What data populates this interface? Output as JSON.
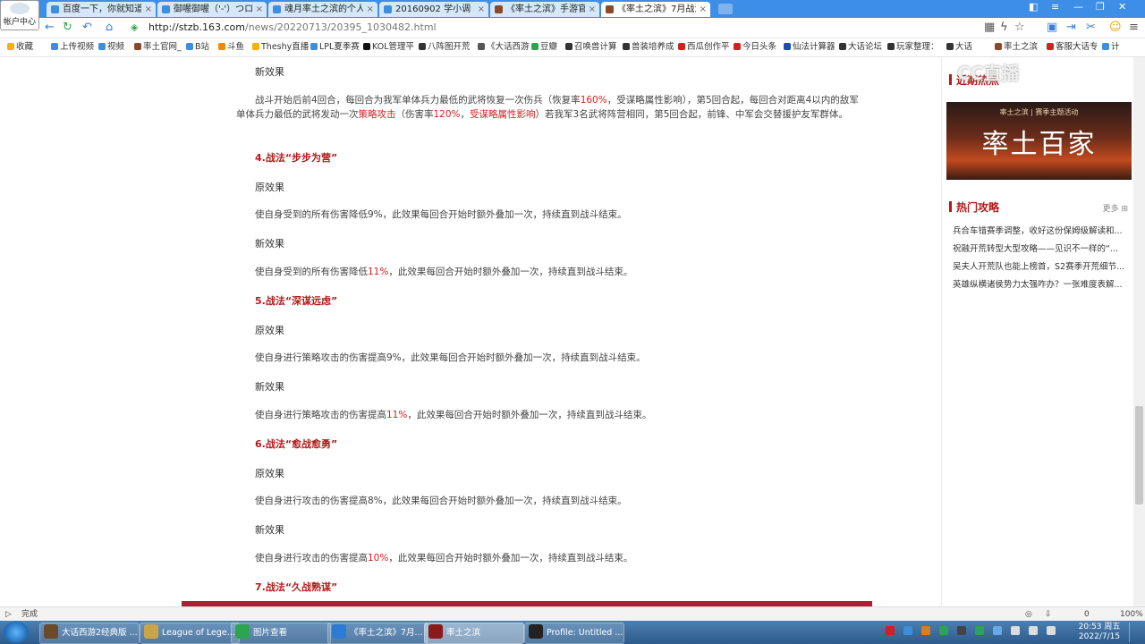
{
  "browser": {
    "account_label": "帐户中心",
    "tabs": [
      {
        "title": "百度一下，你就知道"
      },
      {
        "title": "御喔御喔（'-'）つロ 干"
      },
      {
        "title": "魂月率土之滨的个人空间"
      },
      {
        "title": "20160902 学小调 郭德"
      },
      {
        "title": "《率土之滨》手游官网_"
      },
      {
        "title": "《率土之滨》7月战法平"
      }
    ],
    "close_glyph": "×",
    "url_host": "http://stzb.163.com",
    "url_path": "/news/20220713/20395_1030482.html",
    "bookmarks": [
      "收藏",
      "上传视频",
      "视频",
      "率土官网_",
      "B站",
      "斗鱼",
      "Theshy直播",
      "LPL夏季赛",
      "KOL管理平",
      "八阵图开荒",
      "《大话西游",
      "豆瓣",
      "召唤兽计算",
      "兽装培养成",
      "西瓜创作平",
      "今日头条",
      "仙法计算器",
      "大话论坛",
      "玩家整理：",
      "大话",
      "率土之滨",
      "客服大话专",
      "计"
    ]
  },
  "article": {
    "top_label": "新效果",
    "top_para_1": "战斗开始后前4回合，每回合为我军单体兵力最低的武将恢复一次伤兵（恢复率",
    "top_para_r1": "160%",
    "top_para_2": "，受谋略属性影响），第5回合起，每回合对距离4以内的敌军单体兵力最低的武将发动一次",
    "top_para_r2": "策略攻击",
    "top_para_3": "（伤害率",
    "top_para_r3": "120%",
    "top_para_4": "，",
    "top_para_r4": "受谋略属性影响",
    "top_para_5": "）若我军3名武将阵营相同，第5回合起，前锋、中军会交替援护友军群体。",
    "sections": [
      {
        "heading": "4.战法“步步为营”",
        "old_label": "原效果",
        "old_text": "使自身受到的所有伤害降低9%，此效果每回合开始时额外叠加一次，持续直到战斗结束。",
        "new_label": "新效果",
        "new_pre": "使自身受到的所有伤害降低",
        "new_red": "11%",
        "new_post": "，此效果每回合开始时额外叠加一次，持续直到战斗结束。"
      },
      {
        "heading": "5.战法“深谋远虑”",
        "old_label": "原效果",
        "old_text": "使自身进行策略攻击的伤害提高9%，此效果每回合开始时额外叠加一次，持续直到战斗结束。",
        "new_label": "新效果",
        "new_pre": "使自身进行策略攻击的伤害提高",
        "new_red": "11%",
        "new_post": "，此效果每回合开始时额外叠加一次，持续直到战斗结束。"
      },
      {
        "heading": "6.战法“愈战愈勇”",
        "old_label": "原效果",
        "old_text": "使自身进行攻击的伤害提高8%，此效果每回合开始时额外叠加一次，持续直到战斗结束。",
        "new_label": "新效果",
        "new_pre": "使自身进行攻击的伤害提高",
        "new_red": "10%",
        "new_post": "，此效果每回合开始时额外叠加一次，持续直到战斗结束。"
      }
    ],
    "last_heading": "7.战法“久战熟谋”"
  },
  "sidebar": {
    "recent_title": "近期热点",
    "banner_small": "率土之滨 | 赛季主题活动",
    "banner_big": "率土百家",
    "hot_title": "热门攻略",
    "more": "更多",
    "hot_items": [
      "兵合车错赛季调整，收好这份保姆级解读和...",
      "祝融开荒转型大型攻略——见识不一样的“...",
      "吴夫人开荒队也能上榜首，S2赛季开荒细节...",
      "英雄纵横诸侯势力太强咋办？一张难度表解..."
    ]
  },
  "status": {
    "text": "完成",
    "zoom": "100%",
    "downloads": "0"
  },
  "taskbar": {
    "items": [
      "大话西游2经典版 ...",
      "League of Lege...",
      "图片查看",
      "《率土之滨》7月...",
      "率土之滨",
      "Profile: Untitled ..."
    ],
    "time": "20:53 周五",
    "date": "2022/7/15"
  },
  "watermark": "CC直播"
}
